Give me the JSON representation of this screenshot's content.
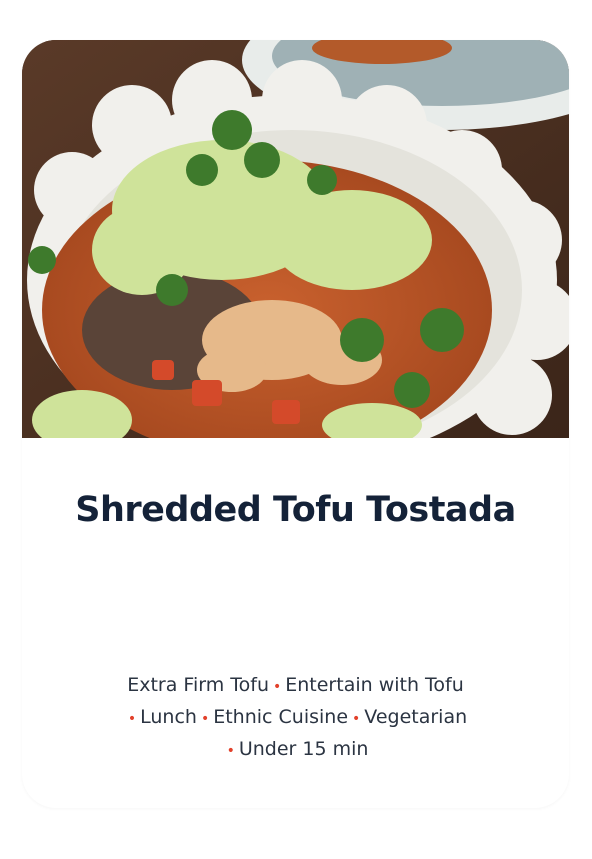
{
  "recipe_card": {
    "title": "Shredded Tofu Tostada",
    "photo_icon": "food-photo",
    "tags": [
      "Extra Firm Tofu",
      "Entertain with Tofu",
      "Lunch",
      "Ethnic Cuisine",
      "Vegetarian",
      "Under 15 min"
    ],
    "separator": "•",
    "colors": {
      "title": "#142238",
      "separator": "#e2412b",
      "tag_text": "#2b3442"
    }
  }
}
